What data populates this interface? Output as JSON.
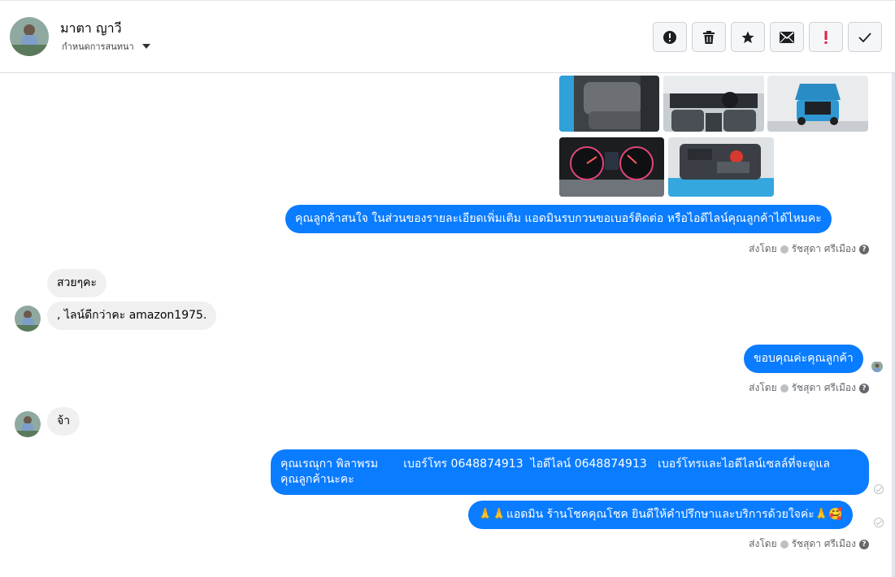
{
  "header": {
    "contact_name": "มาตา ญาวี",
    "sub_label": "กำหนดการสนทนา",
    "toolbar": [
      {
        "name": "report-button",
        "icon": "alert-circle-icon"
      },
      {
        "name": "delete-button",
        "icon": "trash-icon"
      },
      {
        "name": "star-button",
        "icon": "star-icon"
      },
      {
        "name": "mark-unread-button",
        "icon": "envelope-icon"
      },
      {
        "name": "important-button",
        "icon": "exclamation-icon"
      },
      {
        "name": "done-button",
        "icon": "check-icon"
      }
    ]
  },
  "messages": {
    "out1": "คุณลูกค้าสนใจ ในส่วนของรายละเอียดเพิ่มเติม แอดมินรบกวนขอเบอร์ติดต่อ หรือไอดีไลน์คุณลูกค้าได้ไหมคะ",
    "in1": "สวยๆคะ",
    "in2": ", ไลน์ดีกว่าคะ amazon1975.",
    "out2": "ขอบคุณค่ะคุณลูกค้า",
    "in3": "จ้า",
    "out3_line1": "คุณเรณุกา พิลาพรม       เบอร์โทร 0648874913  ไอดีไลน์ 0648874913   เบอร์โทรและไอดีไลน์เซลล์ที่จะดูแล",
    "out3_line2": "คุณลูกค้านะคะ",
    "out4": "🙏🙏แอดมิน ร้านโชคคุณโชค ยินดีให้คำปรึกษาและบริการด้วยใจค่ะ🙏🥰"
  },
  "sent_by": {
    "prefix": "ส่งโดย",
    "agent": "รัชสุดา ศรีเมือง"
  },
  "colors": {
    "accent": "#0a7cff",
    "incoming": "#f0f0f0",
    "meta_text": "#65676b"
  }
}
